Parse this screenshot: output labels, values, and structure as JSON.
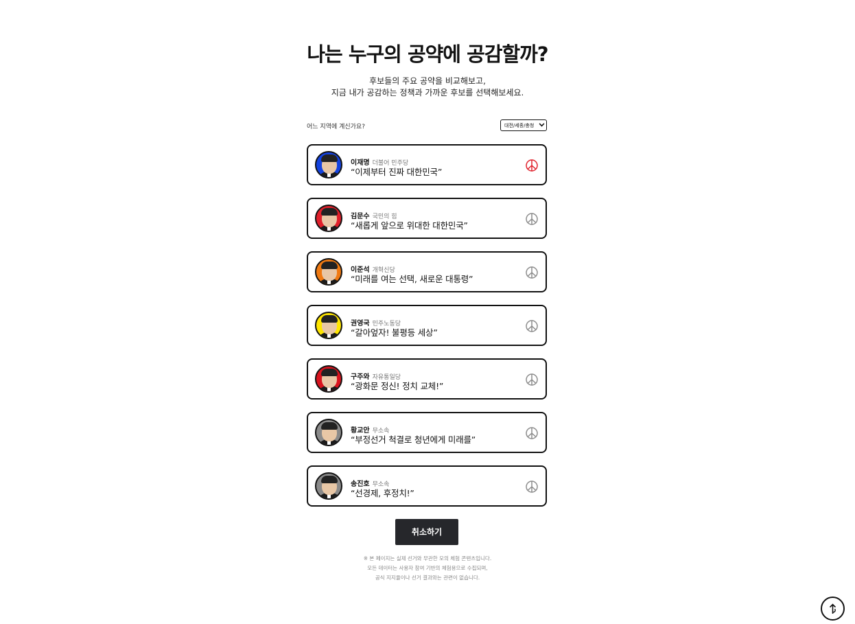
{
  "header": {
    "title": "나는 누구의 공약에 공감할까?",
    "subtitle_lines": [
      "후보들의 주요 공약을 비교해보고,",
      "지금 내가 공감하는 정책과 가까운 후보를 선택해보세요."
    ]
  },
  "region": {
    "label": "어느 지역에 계신가요?",
    "selected": "대전/세종/충청"
  },
  "candidates": [
    {
      "name": "이재명",
      "party": "더불어 민주당",
      "slogan": "“이제부터 진짜 대한민국”",
      "avatar_color": "#1443e0",
      "selected": true
    },
    {
      "name": "김문수",
      "party": "국민의 힘",
      "slogan": "“새롭게 앞으로 위대한 대한민국”",
      "avatar_color": "#e0202b",
      "selected": false
    },
    {
      "name": "이준석",
      "party": "개혁신당",
      "slogan": "“미래를 여는 선택, 새로운 대통령”",
      "avatar_color": "#f07a12",
      "selected": false
    },
    {
      "name": "권영국",
      "party": "민주노동당",
      "slogan": "“갈아엎자! 불평등 세상”",
      "avatar_color": "#ffe600",
      "selected": false
    },
    {
      "name": "구주와",
      "party": "자유통일당",
      "slogan": "“광화문 정신! 정치 교체!”",
      "avatar_color": "#d8141f",
      "selected": false
    },
    {
      "name": "황교안",
      "party": "무소속",
      "slogan": "“부정선거 척결로 청년에게 미래를”",
      "avatar_color": "#8a8a8a",
      "selected": false
    },
    {
      "name": "송진호",
      "party": "무소속",
      "slogan": "“선경제, 후정치!”",
      "avatar_color": "#8a8a8a",
      "selected": false
    }
  ],
  "vote_icon": "vote-stamp-icon",
  "colors": {
    "selected_stamp": "#e0202b",
    "unselected_stamp": "#8c8c8c",
    "cancel_button_bg": "#26272b"
  },
  "cancel_button_label": "취소하기",
  "disclaimer_lines": [
    "※ 본 페이지는 실제 선거와 무관한 모의 체험 콘텐츠입니다.",
    "모든 데이터는 사용자 참여 기반의 체험용으로 수집되며,",
    "공식 지지율이나 선거 결과와는 관련이 없습니다."
  ],
  "scroll_top_icon": "scroll-top-icon"
}
